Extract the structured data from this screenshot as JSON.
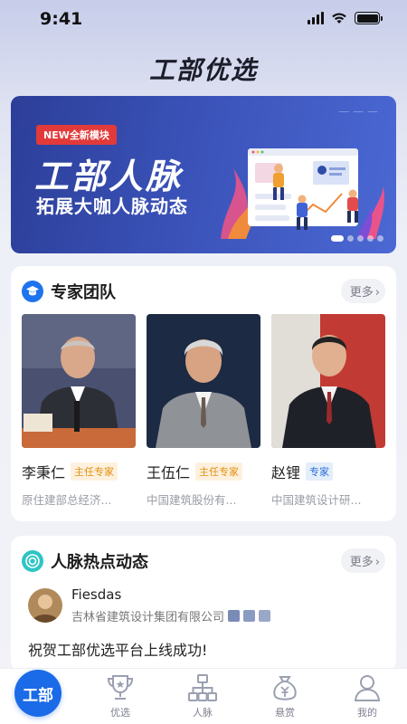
{
  "status_bar": {
    "time": "9:41"
  },
  "app_title": "工部优选",
  "banner": {
    "badge_new": "NEW",
    "badge_text": "全新模块",
    "title": "工部人脉",
    "subtitle": "拓展大咖人脉动态",
    "slide_count": 5,
    "active_slide": 1
  },
  "experts_section": {
    "title": "专家团队",
    "more_label": "更多",
    "experts": [
      {
        "name": "李秉仁",
        "tag": "主任专家",
        "org": "原住建部总经济..."
      },
      {
        "name": "王伍仁",
        "tag": "主任专家",
        "org": "中国建筑股份有..."
      },
      {
        "name": "赵锂",
        "tag": "专家",
        "org": "中国建筑设计研..."
      }
    ]
  },
  "news_section": {
    "title": "人脉热点动态",
    "more_label": "更多",
    "post": {
      "user_name": "Fiesdas",
      "user_org": "吉林省建筑设计集团有限公司",
      "content": "祝贺工部优选平台上线成功!"
    }
  },
  "tabbar": {
    "home_label": "工部",
    "tabs": [
      {
        "label": "优选",
        "icon": "trophy-icon"
      },
      {
        "label": "人脉",
        "icon": "network-icon"
      },
      {
        "label": "悬赏",
        "icon": "money-bag-icon"
      },
      {
        "label": "我的",
        "icon": "person-icon"
      }
    ]
  },
  "colors": {
    "primary": "#1b6ae8",
    "banner": "#3a52b8",
    "tag_orange": "#e48f0e",
    "tag_blue": "#2a6fd6"
  }
}
